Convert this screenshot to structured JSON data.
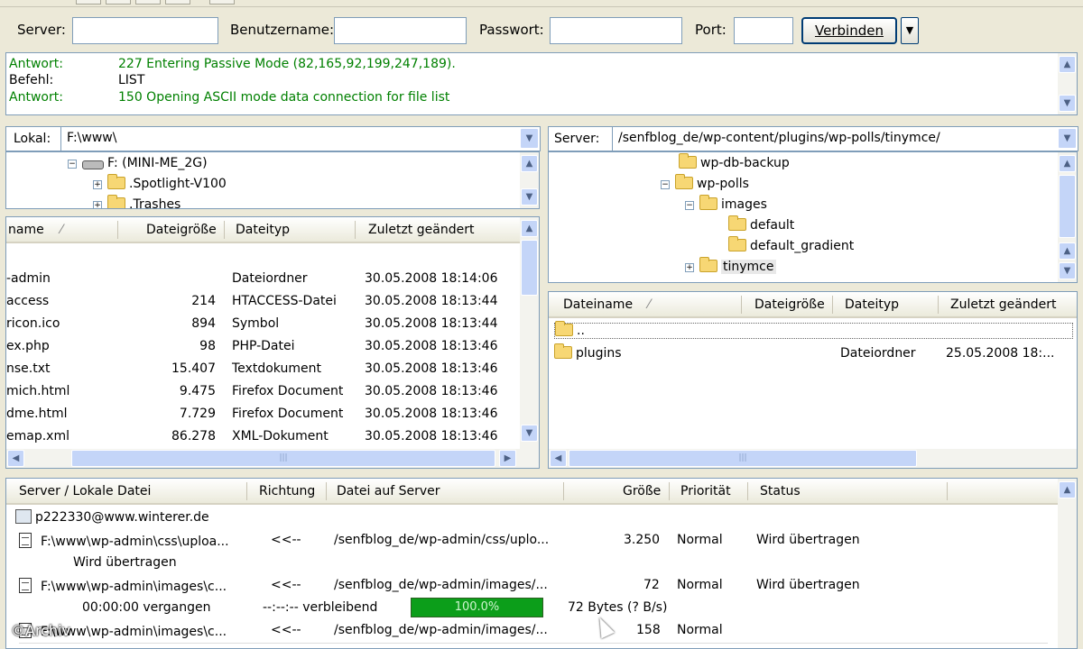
{
  "quickconnect": {
    "server_label": "Server:",
    "user_label": "Benutzername:",
    "password_label": "Passwort:",
    "port_label": "Port:",
    "server_value": "",
    "user_value": "",
    "password_value": "",
    "port_value": "",
    "connect_label": "Verbinden",
    "dropdown_icon": "triangle-down"
  },
  "log": [
    {
      "type": "Antwort:",
      "text": "227 Entering Passive Mode (82,165,92,199,247,189).",
      "color": "#008000"
    },
    {
      "type": "Befehl:",
      "text": "LIST",
      "color": "#000000"
    },
    {
      "type": "Antwort:",
      "text": "150 Opening ASCII mode data connection for file list",
      "color": "#008000"
    }
  ],
  "local": {
    "label": "Lokal:",
    "path": "F:\\www\\",
    "tree": [
      {
        "label": "F: (MINI-ME_2G)",
        "expander": "−",
        "icon": "drive-icon"
      },
      {
        "label": ".Spotlight-V100",
        "expander": "+",
        "icon": "folder-icon"
      },
      {
        "label": ".Trashes",
        "expander": "+",
        "icon": "folder-icon"
      }
    ],
    "columns": [
      "name",
      "Dateigröße",
      "Dateityp",
      "Zuletzt geändert"
    ],
    "sort_indicator": "⁄",
    "files": [
      {
        "name": "-admin",
        "size": "",
        "type": "Dateiordner",
        "modified": "30.05.2008 18:14:06"
      },
      {
        "name": "access",
        "size": "214",
        "type": "HTACCESS-Datei",
        "modified": "30.05.2008 18:13:44"
      },
      {
        "name": "ricon.ico",
        "size": "894",
        "type": "Symbol",
        "modified": "30.05.2008 18:13:44"
      },
      {
        "name": "ex.php",
        "size": "98",
        "type": "PHP-Datei",
        "modified": "30.05.2008 18:13:46"
      },
      {
        "name": "nse.txt",
        "size": "15.407",
        "type": "Textdokument",
        "modified": "30.05.2008 18:13:46"
      },
      {
        "name": "mich.html",
        "size": "9.475",
        "type": "Firefox Document",
        "modified": "30.05.2008 18:13:46"
      },
      {
        "name": "dme.html",
        "size": "7.729",
        "type": "Firefox Document",
        "modified": "30.05.2008 18:13:46"
      },
      {
        "name": "emap.xml",
        "size": "86.278",
        "type": "XML-Dokument",
        "modified": "30.05.2008 18:13:46"
      }
    ]
  },
  "remote": {
    "label": "Server:",
    "path": "/senfblog_de/wp-content/plugins/wp-polls/tinymce/",
    "tree": [
      {
        "label": "wp-db-backup",
        "expander": ""
      },
      {
        "label": "wp-polls",
        "expander": "−"
      },
      {
        "label": "images",
        "expander": "−"
      },
      {
        "label": "default",
        "expander": ""
      },
      {
        "label": "default_gradient",
        "expander": ""
      },
      {
        "label": "tinymce",
        "expander": "+"
      }
    ],
    "columns": [
      "Dateiname",
      "Dateigröße",
      "Dateityp",
      "Zuletzt geändert"
    ],
    "sort_indicator": "⁄",
    "files": [
      {
        "name": "..",
        "size": "",
        "type": "",
        "modified": ""
      },
      {
        "name": "plugins",
        "size": "",
        "type": "Dateiordner",
        "modified": "25.05.2008 18:..."
      }
    ]
  },
  "queue": {
    "columns": [
      "Server / Lokale Datei",
      "Richtung",
      "Datei auf Server",
      "Größe",
      "Priorität",
      "Status"
    ],
    "server": "p222330@www.winterer.de",
    "items": [
      {
        "local": "F:\\www\\wp-admin\\css\\uploa...",
        "dir": "<<--",
        "remote": "/senfblog_de/wp-admin/css/uplo...",
        "size": "3.250",
        "priority": "Normal",
        "status": "Wird übertragen",
        "detail": "Wird übertragen"
      },
      {
        "local": "F:\\www\\wp-admin\\images\\c...",
        "dir": "<<--",
        "remote": "/senfblog_de/wp-admin/images/...",
        "size": "72",
        "priority": "Normal",
        "status": "Wird übertragen",
        "elapsed": "00:00:00 vergangen",
        "remaining": "--:--:-- verbleibend",
        "progress_label": "100.0%",
        "progress_value": 100,
        "bytes": "72 Bytes (? B/s)"
      },
      {
        "local": "F:\\www\\wp-admin\\images\\c...",
        "dir": "<<--",
        "remote": "/senfblog_de/wp-admin/images/...",
        "size": "158",
        "priority": "Normal",
        "status": ""
      }
    ]
  },
  "watermark": "©Archiv",
  "colors": {
    "log_green": "#008000",
    "progress": "#0c9e1a",
    "scrollbar": "#c4d5f8",
    "window_bg": "#ece9d8"
  }
}
